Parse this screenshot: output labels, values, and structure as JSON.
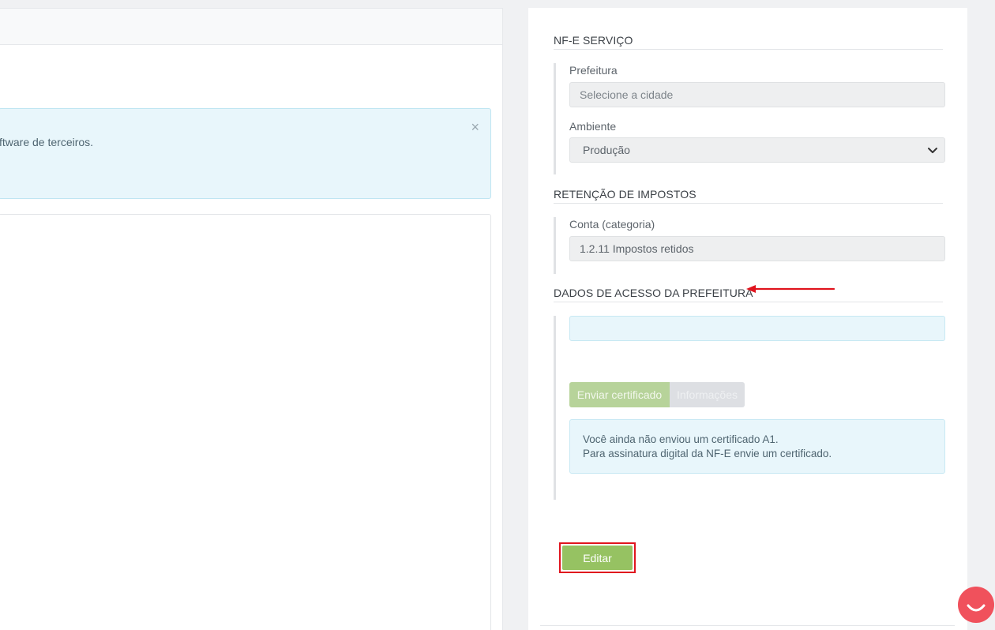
{
  "left": {
    "alert_text": "ftware de terceiros.",
    "alert_close": "×"
  },
  "nfe": {
    "title": "NF-E SERVIÇO",
    "prefeitura_label": "Prefeitura",
    "prefeitura_placeholder": "Selecione a cidade",
    "ambiente_label": "Ambiente",
    "ambiente_value": "Produção"
  },
  "retencao": {
    "title": "RETENÇÃO DE IMPOSTOS",
    "conta_label": "Conta (categoria)",
    "conta_value": "1.2.11  Impostos retidos"
  },
  "acesso": {
    "title": "DADOS DE ACESSO DA PREFEITURA",
    "send_cert_label": "Enviar certificado",
    "info_label": "Informações",
    "cert_msg_line1": "Você ainda não enviou um certificado A1.",
    "cert_msg_line2": "Para assinatura digital da NF-E envie um certificado."
  },
  "actions": {
    "edit_label": "Editar"
  },
  "colors": {
    "annotation_red": "#e0141e",
    "primary_green": "#96c262",
    "chat_widget": "#f0515c"
  }
}
